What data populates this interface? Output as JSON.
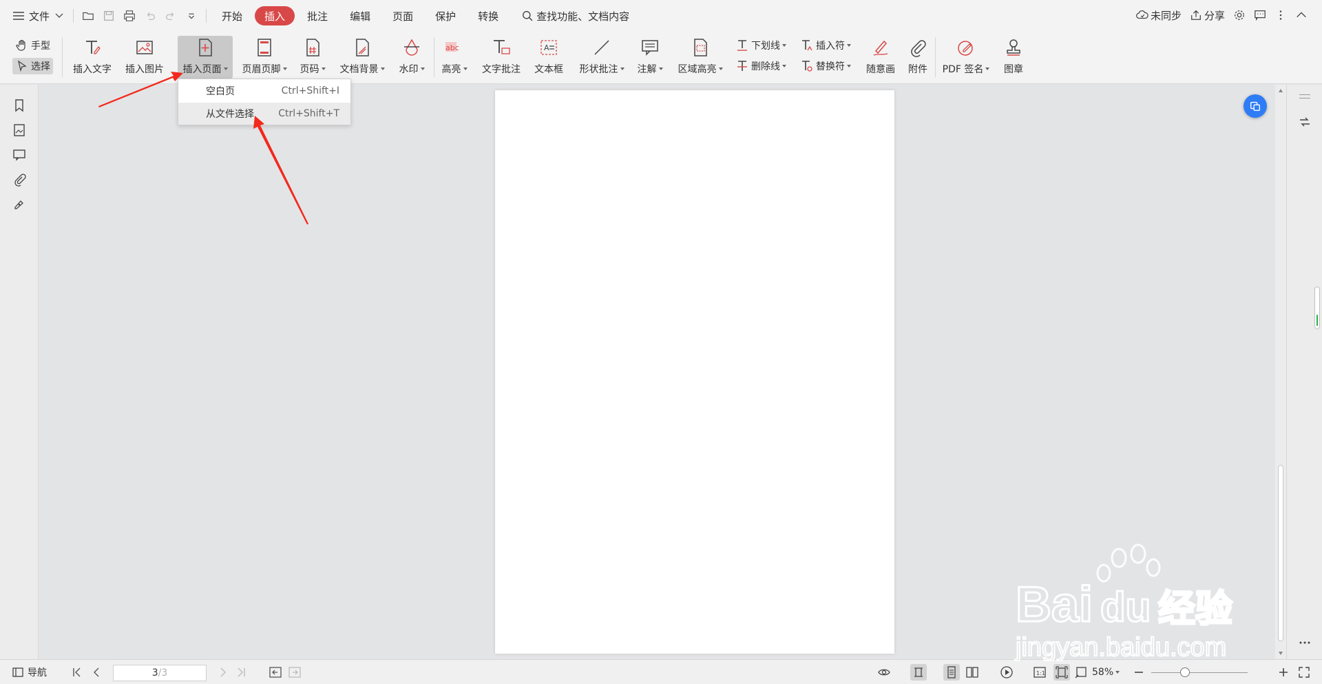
{
  "menubar": {
    "file_label": "文件",
    "tabs": [
      {
        "label": "开始",
        "active": false
      },
      {
        "label": "插入",
        "active": true
      },
      {
        "label": "批注",
        "active": false
      },
      {
        "label": "编辑",
        "active": false
      },
      {
        "label": "页面",
        "active": false
      },
      {
        "label": "保护",
        "active": false
      },
      {
        "label": "转换",
        "active": false
      }
    ],
    "search_placeholder": "查找功能、文档内容",
    "sync_label": "未同步",
    "share_label": "分享",
    "accent_color": "#d94848"
  },
  "ribbon": {
    "hand_label": "手型",
    "select_label": "选择",
    "buttons": {
      "insert_text": "插入文字",
      "insert_image": "插入图片",
      "insert_page": "插入页面",
      "header_footer": "页眉页脚",
      "page_number": "页码",
      "doc_background": "文档背景",
      "watermark": "水印",
      "highlight": "高亮",
      "text_comment": "文字批注",
      "text_box": "文本框",
      "shape_comment": "形状批注",
      "annotation": "注解",
      "area_highlight": "区域高亮",
      "underline": "下划线",
      "strikethrough": "删除线",
      "insert_mark": "插入符",
      "replace_mark": "替换符",
      "freehand": "随意画",
      "attachment": "附件",
      "pdf_sign": "PDF 签名",
      "stamp": "图章"
    }
  },
  "dropdown": {
    "items": [
      {
        "label": "空白页",
        "shortcut": "Ctrl+Shift+I"
      },
      {
        "label": "从文件选择",
        "shortcut": "Ctrl+Shift+T"
      }
    ]
  },
  "statusbar": {
    "nav_label": "导航",
    "page_current": "3",
    "page_total": "/3",
    "zoom": "58%"
  },
  "watermark": {
    "brand": "Bai",
    "brand_tail": "du",
    "cn": "经验",
    "url": "jingyan.baidu.com"
  }
}
